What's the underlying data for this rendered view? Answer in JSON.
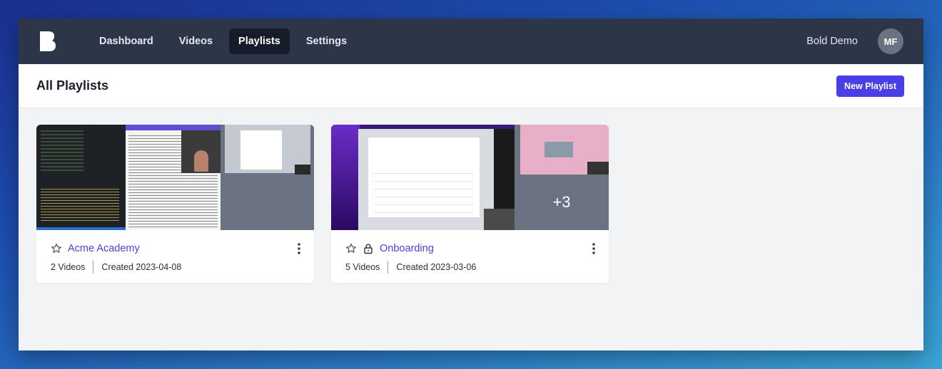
{
  "nav": {
    "items": [
      {
        "label": "Dashboard",
        "active": false
      },
      {
        "label": "Videos",
        "active": false
      },
      {
        "label": "Playlists",
        "active": true
      },
      {
        "label": "Settings",
        "active": false
      }
    ],
    "account_name": "Bold Demo",
    "avatar_initials": "MF"
  },
  "page": {
    "title": "All Playlists",
    "new_button_label": "New Playlist"
  },
  "playlists": [
    {
      "name": "Acme Academy",
      "videos": "2 Videos",
      "created": "Created 2023-04-08",
      "locked": false,
      "more_count": ""
    },
    {
      "name": "Onboarding",
      "videos": "5 Videos",
      "created": "Created 2023-03-06",
      "locked": true,
      "more_count": "+3"
    }
  ],
  "colors": {
    "accent": "#4a3ee6",
    "nav_bg": "#2d3648",
    "nav_active": "#161c29"
  }
}
